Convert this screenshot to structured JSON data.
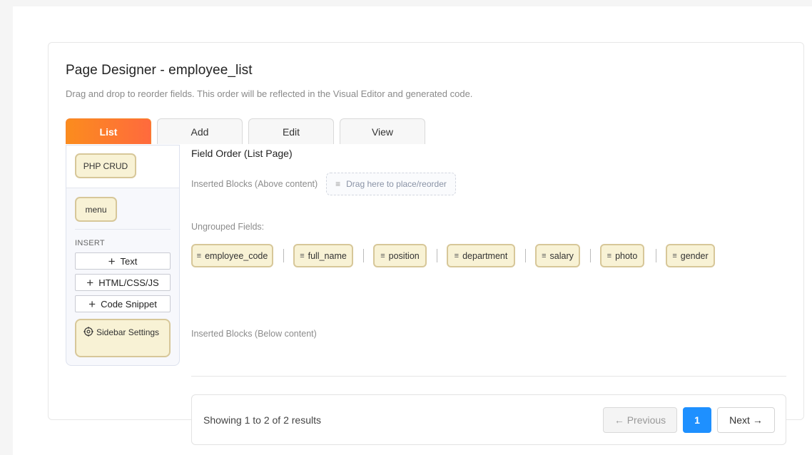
{
  "designer": {
    "title": "Page Designer - employee_list",
    "subtitle": "Drag and drop to reorder fields. This order will be reflected in the Visual Editor and generated code."
  },
  "tabs": [
    {
      "label": "List",
      "active": true
    },
    {
      "label": "Add",
      "active": false
    },
    {
      "label": "Edit",
      "active": false
    },
    {
      "label": "View",
      "active": false
    }
  ],
  "sidebar": {
    "brand_chip": "PHP CRUD",
    "menu_chip": "menu",
    "insert_label": "INSERT",
    "insert_buttons": [
      {
        "label": "Text",
        "icon": "plus-icon"
      },
      {
        "label": "HTML/CSS/JS",
        "icon": "plus-icon"
      },
      {
        "label": "Code Snippet",
        "icon": "plus-icon"
      }
    ],
    "settings_label": "Sidebar Settings",
    "settings_icon": "gear-icon"
  },
  "content": {
    "field_order_title": "Field Order (List Page)",
    "inserted_above_label": "Inserted Blocks (Above content)",
    "dropzone_label": "Drag here to place/reorder",
    "ungrouped_label": "Ungrouped Fields:",
    "fields": [
      "employee_code",
      "full_name",
      "position",
      "department",
      "salary",
      "photo",
      "gender"
    ],
    "inserted_below_label": "Inserted Blocks (Below content)"
  },
  "pagination": {
    "summary": "Showing 1 to 2 of 2 results",
    "previous_label": "← Previous",
    "current_page": "1",
    "next_label": "Next →"
  },
  "colors": {
    "active_tab_start": "#fb8c1e",
    "active_tab_end": "#ff6a3d",
    "chip_bg": "#f8f2d5",
    "chip_border": "#d7c799",
    "page_active": "#1e90ff"
  }
}
